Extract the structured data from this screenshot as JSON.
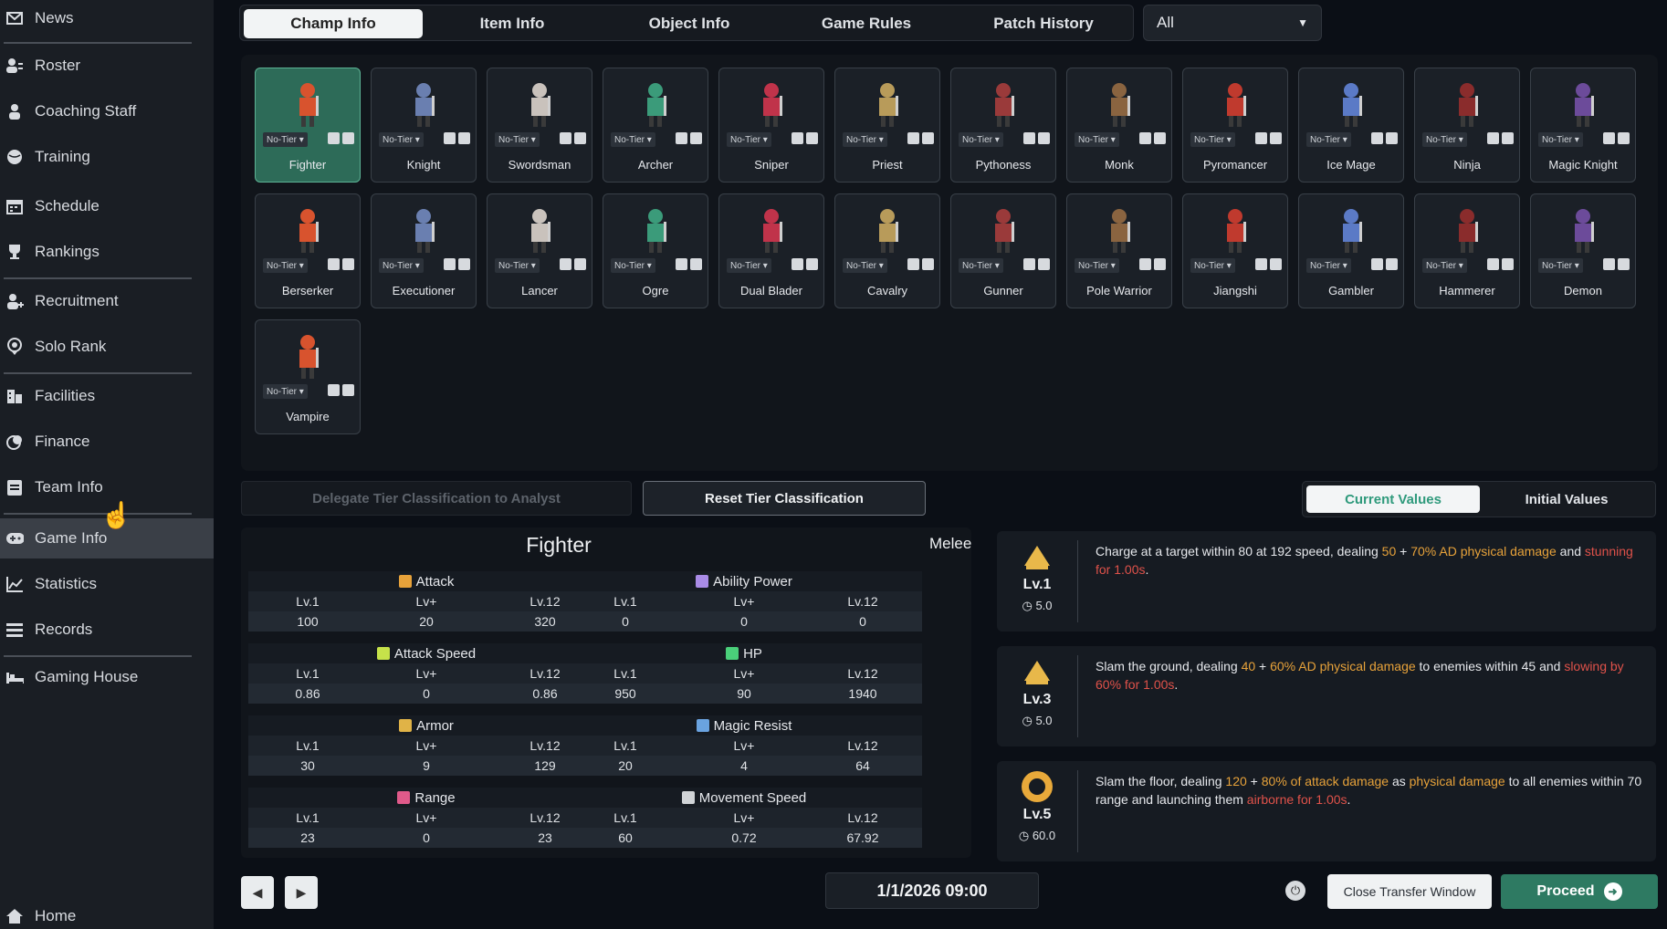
{
  "sidebar": {
    "items": [
      {
        "label": "News",
        "icon": "mail-icon"
      },
      {
        "label": "Roster",
        "icon": "users-icon"
      },
      {
        "label": "Coaching Staff",
        "icon": "person-icon"
      },
      {
        "label": "Training",
        "icon": "globe-icon"
      },
      {
        "label": "Schedule",
        "icon": "calendar-icon"
      },
      {
        "label": "Rankings",
        "icon": "trophy-icon"
      },
      {
        "label": "Recruitment",
        "icon": "person-add-icon"
      },
      {
        "label": "Solo Rank",
        "icon": "pin-icon"
      },
      {
        "label": "Facilities",
        "icon": "building-icon"
      },
      {
        "label": "Finance",
        "icon": "coins-icon"
      },
      {
        "label": "Team Info",
        "icon": "clipboard-icon"
      },
      {
        "label": "Game Info",
        "icon": "gamepad-icon"
      },
      {
        "label": "Statistics",
        "icon": "chart-icon"
      },
      {
        "label": "Records",
        "icon": "list-icon"
      },
      {
        "label": "Gaming House",
        "icon": "bed-icon"
      },
      {
        "label": "Home",
        "icon": "home-icon"
      }
    ],
    "active": "Game Info"
  },
  "tabs": [
    "Champ Info",
    "Item Info",
    "Object Info",
    "Game Rules",
    "Patch History"
  ],
  "filter": {
    "selected": "All"
  },
  "tier_label": "No-Tier",
  "champions": [
    "Fighter",
    "Knight",
    "Swordsman",
    "Archer",
    "Sniper",
    "Priest",
    "Pythoness",
    "Monk",
    "Pyromancer",
    "Ice Mage",
    "Ninja",
    "Magic Knight",
    "Berserker",
    "Executioner",
    "Lancer",
    "Ogre",
    "Dual Blader",
    "Cavalry",
    "Gunner",
    "Pole Warrior",
    "Jiangshi",
    "Gambler",
    "Hammerer",
    "Demon",
    "Vampire"
  ],
  "buttons": {
    "delegate": "Delegate Tier Classification to Analyst",
    "reset": "Reset Tier Classification",
    "current_values": "Current Values",
    "initial_values": "Initial Values",
    "close_transfer": "Close Transfer Window",
    "proceed": "Proceed"
  },
  "champion": {
    "name": "Fighter",
    "type": "Melee",
    "col_headers": [
      "Lv.1",
      "Lv+",
      "Lv.12"
    ],
    "stats": [
      {
        "name": "Attack",
        "values": [
          "100",
          "20",
          "320"
        ]
      },
      {
        "name": "Ability Power",
        "values": [
          "0",
          "0",
          "0"
        ]
      },
      {
        "name": "Attack Speed",
        "values": [
          "0.86",
          "0",
          "0.86"
        ]
      },
      {
        "name": "HP",
        "values": [
          "950",
          "90",
          "1940"
        ]
      },
      {
        "name": "Armor",
        "values": [
          "30",
          "9",
          "129"
        ]
      },
      {
        "name": "Magic Resist",
        "values": [
          "20",
          "4",
          "64"
        ]
      },
      {
        "name": "Range",
        "values": [
          "23",
          "0",
          "23"
        ]
      },
      {
        "name": "Movement Speed",
        "values": [
          "60",
          "0.72",
          "67.92"
        ]
      }
    ]
  },
  "skills": [
    {
      "level": "Lv.1",
      "cooldown": "5.0",
      "desc": [
        "Charge at a target within 80 at 192 speed, dealing ",
        "50",
        " + ",
        "70% AD physical damage",
        " and ",
        "stunning for 1.00s",
        "."
      ]
    },
    {
      "level": "Lv.3",
      "cooldown": "5.0",
      "desc": [
        "Slam the ground, dealing ",
        "40",
        " + ",
        "60% AD physical damage",
        " to enemies within 45 and ",
        "slowing by 60% for 1.00s",
        "."
      ]
    },
    {
      "level": "Lv.5",
      "cooldown": "60.0",
      "desc": [
        "Slam the floor, dealing ",
        "120",
        " + ",
        "80% of attack damage",
        " as ",
        "physical damage",
        " to all enemies within 70 range and launching them ",
        "airborne for 1.00s",
        "."
      ]
    }
  ],
  "date": "1/1/2026 09:00"
}
